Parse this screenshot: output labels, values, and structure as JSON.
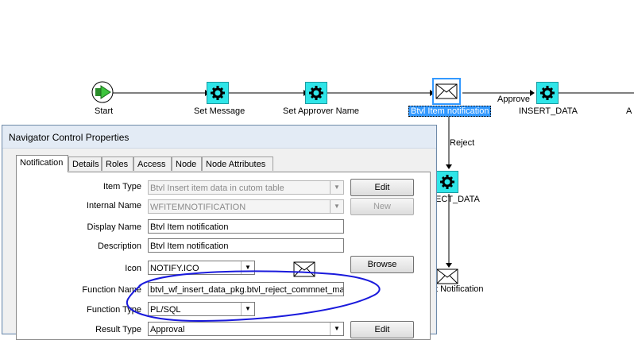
{
  "diagram": {
    "nodes": [
      {
        "id": "start",
        "label": "Start",
        "icon": "start-process-icon"
      },
      {
        "id": "set-message",
        "label": "Set Message",
        "icon": "gear-icon"
      },
      {
        "id": "set-approver-name",
        "label": "Set Approver Name",
        "icon": "gear-icon"
      },
      {
        "id": "btvl-item-notification",
        "label": "Btvl Item notification",
        "icon": "envelope-icon"
      },
      {
        "id": "insert-data",
        "label": "INSERT_DATA",
        "icon": "gear-icon"
      },
      {
        "id": "reject-data",
        "label": "ECT_DATA",
        "icon": "gear-icon"
      },
      {
        "id": "reject-notification",
        "label": "t Notification",
        "icon": "envelope-icon"
      },
      {
        "id": "cutoff-right",
        "label": "A",
        "icon": "none"
      }
    ],
    "edge_labels": {
      "approve": "Approve",
      "reject": "Reject"
    }
  },
  "dialog": {
    "title": "Navigator Control Properties",
    "tabs": [
      "Notification",
      "Details",
      "Roles",
      "Access",
      "Node",
      "Node Attributes"
    ],
    "active_tab": "Notification",
    "fields": {
      "item_type": {
        "label": "Item Type",
        "value": "Btvl Insert item data in cutom table"
      },
      "internal_name": {
        "label": "Internal Name",
        "value": "WFITEMNOTIFICATION"
      },
      "display_name": {
        "label": "Display Name",
        "value": "Btvl Item notification"
      },
      "description": {
        "label": "Description",
        "value": "Btvl Item notification"
      },
      "icon": {
        "label": "Icon",
        "value": "NOTIFY.ICO"
      },
      "function_name": {
        "label": "Function Name",
        "value": "btvl_wf_insert_data_pkg.btvl_reject_commnet_man"
      },
      "function_type": {
        "label": "Function Type",
        "value": "PL/SQL"
      },
      "result_type": {
        "label": "Result Type",
        "value": "Approval"
      }
    },
    "buttons": {
      "edit": "Edit",
      "new": "New",
      "browse": "Browse",
      "edit2": "Edit"
    }
  },
  "annotation": {
    "color": "#1a1adc"
  }
}
